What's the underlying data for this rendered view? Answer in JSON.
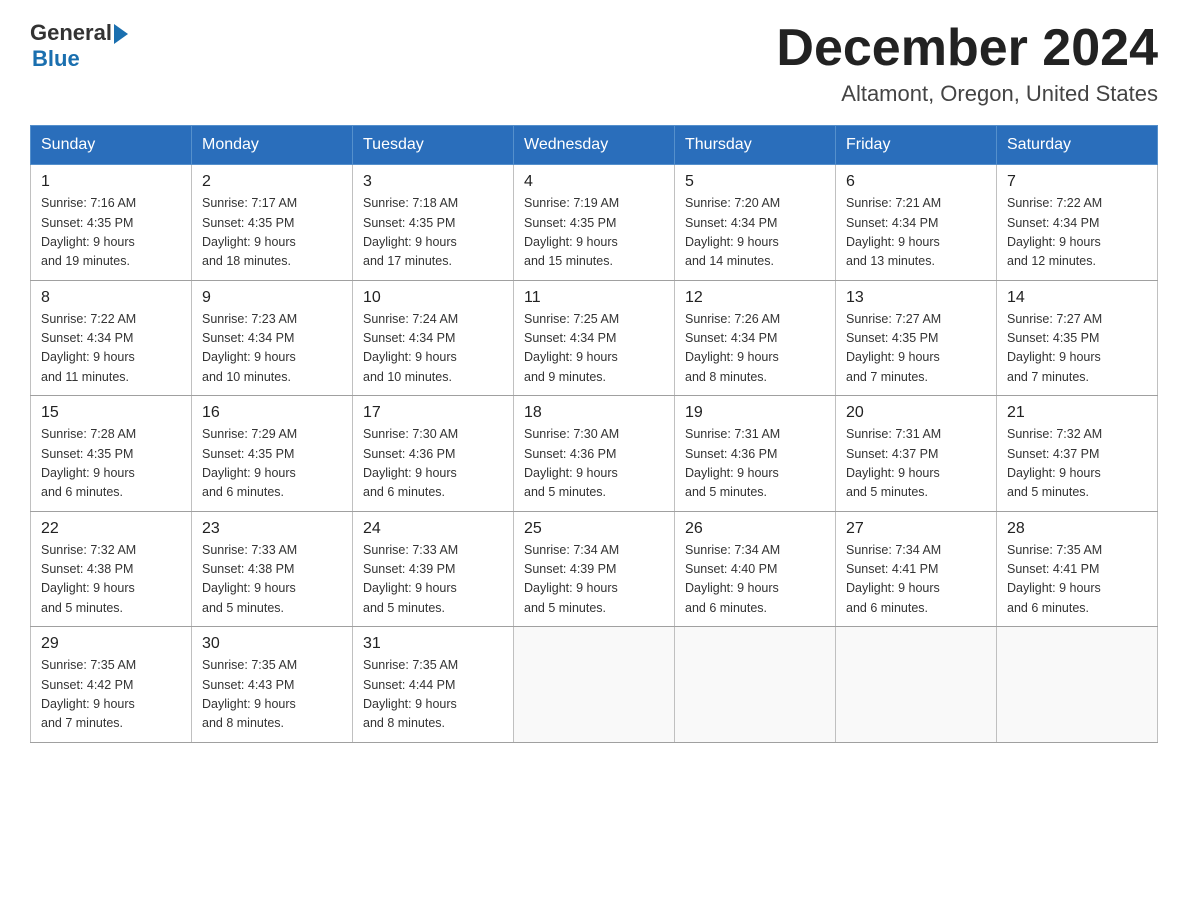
{
  "header": {
    "title": "December 2024",
    "subtitle": "Altamont, Oregon, United States"
  },
  "logo": {
    "general": "General",
    "blue": "Blue"
  },
  "days_of_week": [
    "Sunday",
    "Monday",
    "Tuesday",
    "Wednesday",
    "Thursday",
    "Friday",
    "Saturday"
  ],
  "weeks": [
    [
      {
        "day": "1",
        "sunrise": "7:16 AM",
        "sunset": "4:35 PM",
        "daylight": "9 hours and 19 minutes."
      },
      {
        "day": "2",
        "sunrise": "7:17 AM",
        "sunset": "4:35 PM",
        "daylight": "9 hours and 18 minutes."
      },
      {
        "day": "3",
        "sunrise": "7:18 AM",
        "sunset": "4:35 PM",
        "daylight": "9 hours and 17 minutes."
      },
      {
        "day": "4",
        "sunrise": "7:19 AM",
        "sunset": "4:35 PM",
        "daylight": "9 hours and 15 minutes."
      },
      {
        "day": "5",
        "sunrise": "7:20 AM",
        "sunset": "4:34 PM",
        "daylight": "9 hours and 14 minutes."
      },
      {
        "day": "6",
        "sunrise": "7:21 AM",
        "sunset": "4:34 PM",
        "daylight": "9 hours and 13 minutes."
      },
      {
        "day": "7",
        "sunrise": "7:22 AM",
        "sunset": "4:34 PM",
        "daylight": "9 hours and 12 minutes."
      }
    ],
    [
      {
        "day": "8",
        "sunrise": "7:22 AM",
        "sunset": "4:34 PM",
        "daylight": "9 hours and 11 minutes."
      },
      {
        "day": "9",
        "sunrise": "7:23 AM",
        "sunset": "4:34 PM",
        "daylight": "9 hours and 10 minutes."
      },
      {
        "day": "10",
        "sunrise": "7:24 AM",
        "sunset": "4:34 PM",
        "daylight": "9 hours and 10 minutes."
      },
      {
        "day": "11",
        "sunrise": "7:25 AM",
        "sunset": "4:34 PM",
        "daylight": "9 hours and 9 minutes."
      },
      {
        "day": "12",
        "sunrise": "7:26 AM",
        "sunset": "4:34 PM",
        "daylight": "9 hours and 8 minutes."
      },
      {
        "day": "13",
        "sunrise": "7:27 AM",
        "sunset": "4:35 PM",
        "daylight": "9 hours and 7 minutes."
      },
      {
        "day": "14",
        "sunrise": "7:27 AM",
        "sunset": "4:35 PM",
        "daylight": "9 hours and 7 minutes."
      }
    ],
    [
      {
        "day": "15",
        "sunrise": "7:28 AM",
        "sunset": "4:35 PM",
        "daylight": "9 hours and 6 minutes."
      },
      {
        "day": "16",
        "sunrise": "7:29 AM",
        "sunset": "4:35 PM",
        "daylight": "9 hours and 6 minutes."
      },
      {
        "day": "17",
        "sunrise": "7:30 AM",
        "sunset": "4:36 PM",
        "daylight": "9 hours and 6 minutes."
      },
      {
        "day": "18",
        "sunrise": "7:30 AM",
        "sunset": "4:36 PM",
        "daylight": "9 hours and 5 minutes."
      },
      {
        "day": "19",
        "sunrise": "7:31 AM",
        "sunset": "4:36 PM",
        "daylight": "9 hours and 5 minutes."
      },
      {
        "day": "20",
        "sunrise": "7:31 AM",
        "sunset": "4:37 PM",
        "daylight": "9 hours and 5 minutes."
      },
      {
        "day": "21",
        "sunrise": "7:32 AM",
        "sunset": "4:37 PM",
        "daylight": "9 hours and 5 minutes."
      }
    ],
    [
      {
        "day": "22",
        "sunrise": "7:32 AM",
        "sunset": "4:38 PM",
        "daylight": "9 hours and 5 minutes."
      },
      {
        "day": "23",
        "sunrise": "7:33 AM",
        "sunset": "4:38 PM",
        "daylight": "9 hours and 5 minutes."
      },
      {
        "day": "24",
        "sunrise": "7:33 AM",
        "sunset": "4:39 PM",
        "daylight": "9 hours and 5 minutes."
      },
      {
        "day": "25",
        "sunrise": "7:34 AM",
        "sunset": "4:39 PM",
        "daylight": "9 hours and 5 minutes."
      },
      {
        "day": "26",
        "sunrise": "7:34 AM",
        "sunset": "4:40 PM",
        "daylight": "9 hours and 6 minutes."
      },
      {
        "day": "27",
        "sunrise": "7:34 AM",
        "sunset": "4:41 PM",
        "daylight": "9 hours and 6 minutes."
      },
      {
        "day": "28",
        "sunrise": "7:35 AM",
        "sunset": "4:41 PM",
        "daylight": "9 hours and 6 minutes."
      }
    ],
    [
      {
        "day": "29",
        "sunrise": "7:35 AM",
        "sunset": "4:42 PM",
        "daylight": "9 hours and 7 minutes."
      },
      {
        "day": "30",
        "sunrise": "7:35 AM",
        "sunset": "4:43 PM",
        "daylight": "9 hours and 8 minutes."
      },
      {
        "day": "31",
        "sunrise": "7:35 AM",
        "sunset": "4:44 PM",
        "daylight": "9 hours and 8 minutes."
      },
      null,
      null,
      null,
      null
    ]
  ],
  "labels": {
    "sunrise": "Sunrise:",
    "sunset": "Sunset:",
    "daylight": "Daylight: 9 hours"
  }
}
